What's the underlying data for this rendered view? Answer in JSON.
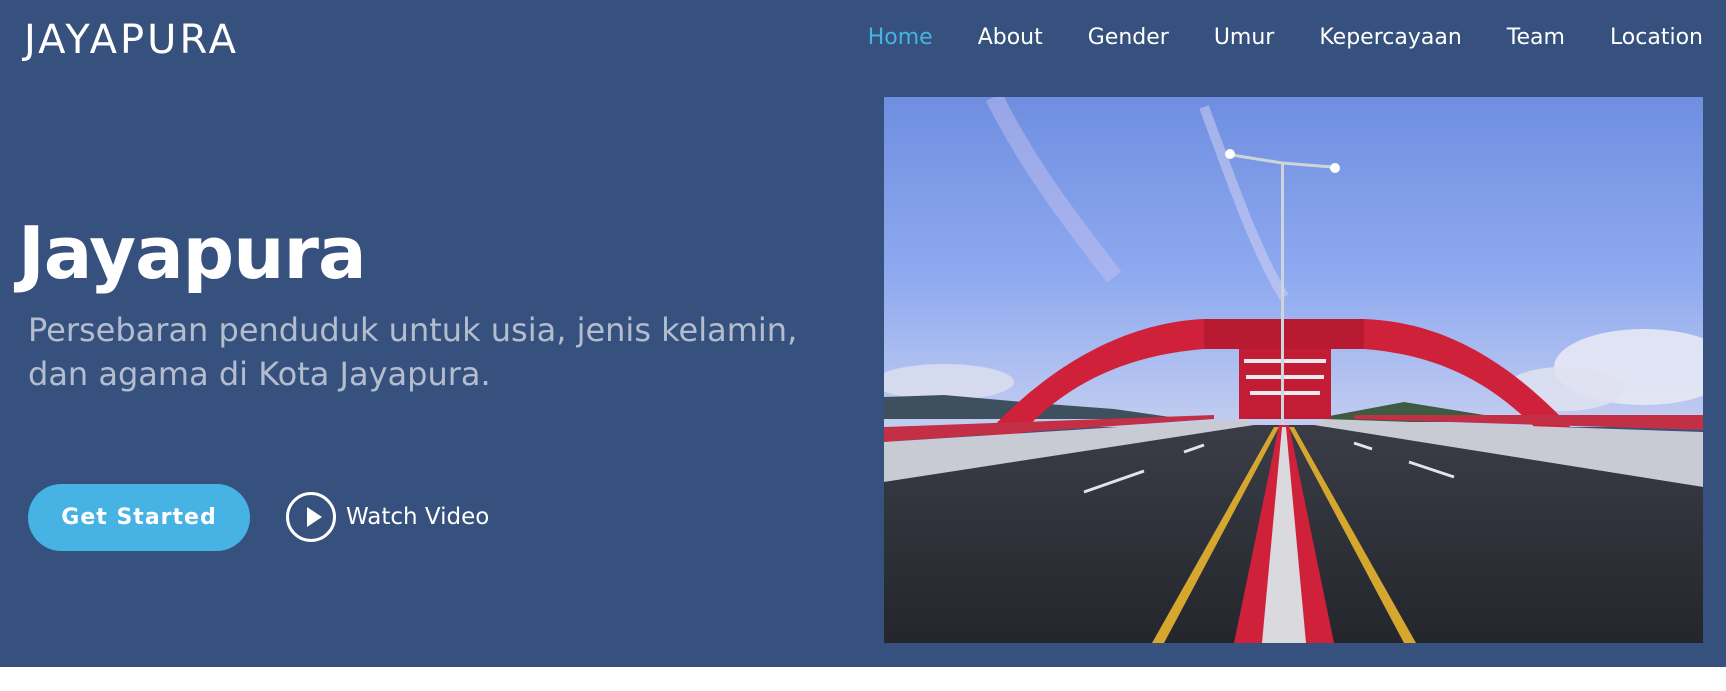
{
  "header": {
    "logo": "JAYAPURA",
    "nav": [
      {
        "label": "Home",
        "active": true
      },
      {
        "label": "About",
        "active": false
      },
      {
        "label": "Gender",
        "active": false
      },
      {
        "label": "Umur",
        "active": false
      },
      {
        "label": "Kepercayaan",
        "active": false
      },
      {
        "label": "Team",
        "active": false
      },
      {
        "label": "Location",
        "active": false
      }
    ]
  },
  "hero": {
    "title": "Jayapura",
    "subtitle": "Persebaran penduduk untuk usia, jenis kelamin, dan agama di Kota Jayapura.",
    "get_started": "Get Started",
    "watch_video": "Watch Video",
    "play_icon": "play-circle-icon",
    "image": "red-arch-bridge-photo"
  },
  "colors": {
    "background": "#37517e",
    "accent": "#47b2e4",
    "text": "#ffffff"
  }
}
